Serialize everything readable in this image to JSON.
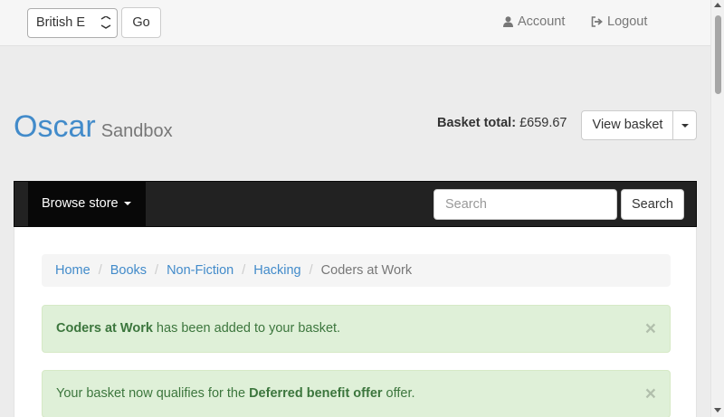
{
  "topbar": {
    "language_value": "British E",
    "go_label": "Go",
    "account_label": "Account",
    "logout_label": "Logout"
  },
  "brand": {
    "name": "Oscar",
    "subtitle": "Sandbox"
  },
  "basket": {
    "total_label": "Basket total:",
    "total_value": "£659.67",
    "view_label": "View basket"
  },
  "navbar": {
    "browse_label": "Browse store",
    "search_placeholder": "Search",
    "search_button": "Search"
  },
  "breadcrumb": {
    "items": [
      "Home",
      "Books",
      "Non-Fiction",
      "Hacking"
    ],
    "current": "Coders at Work"
  },
  "alerts": [
    {
      "bold": "Coders at Work",
      "text": " has been added to your basket.",
      "close": "×"
    },
    {
      "prefix": "Your basket now qualifies for the ",
      "bold": "Deferred benefit offer",
      "suffix": " offer.",
      "close": "×"
    }
  ],
  "colors": {
    "link": "#428bca",
    "navbar_bg": "#222222",
    "alert_success_bg": "#dff0d8",
    "alert_success_text": "#3c763d"
  },
  "icons": {
    "account": "user-icon",
    "logout": "sign-out-icon"
  }
}
